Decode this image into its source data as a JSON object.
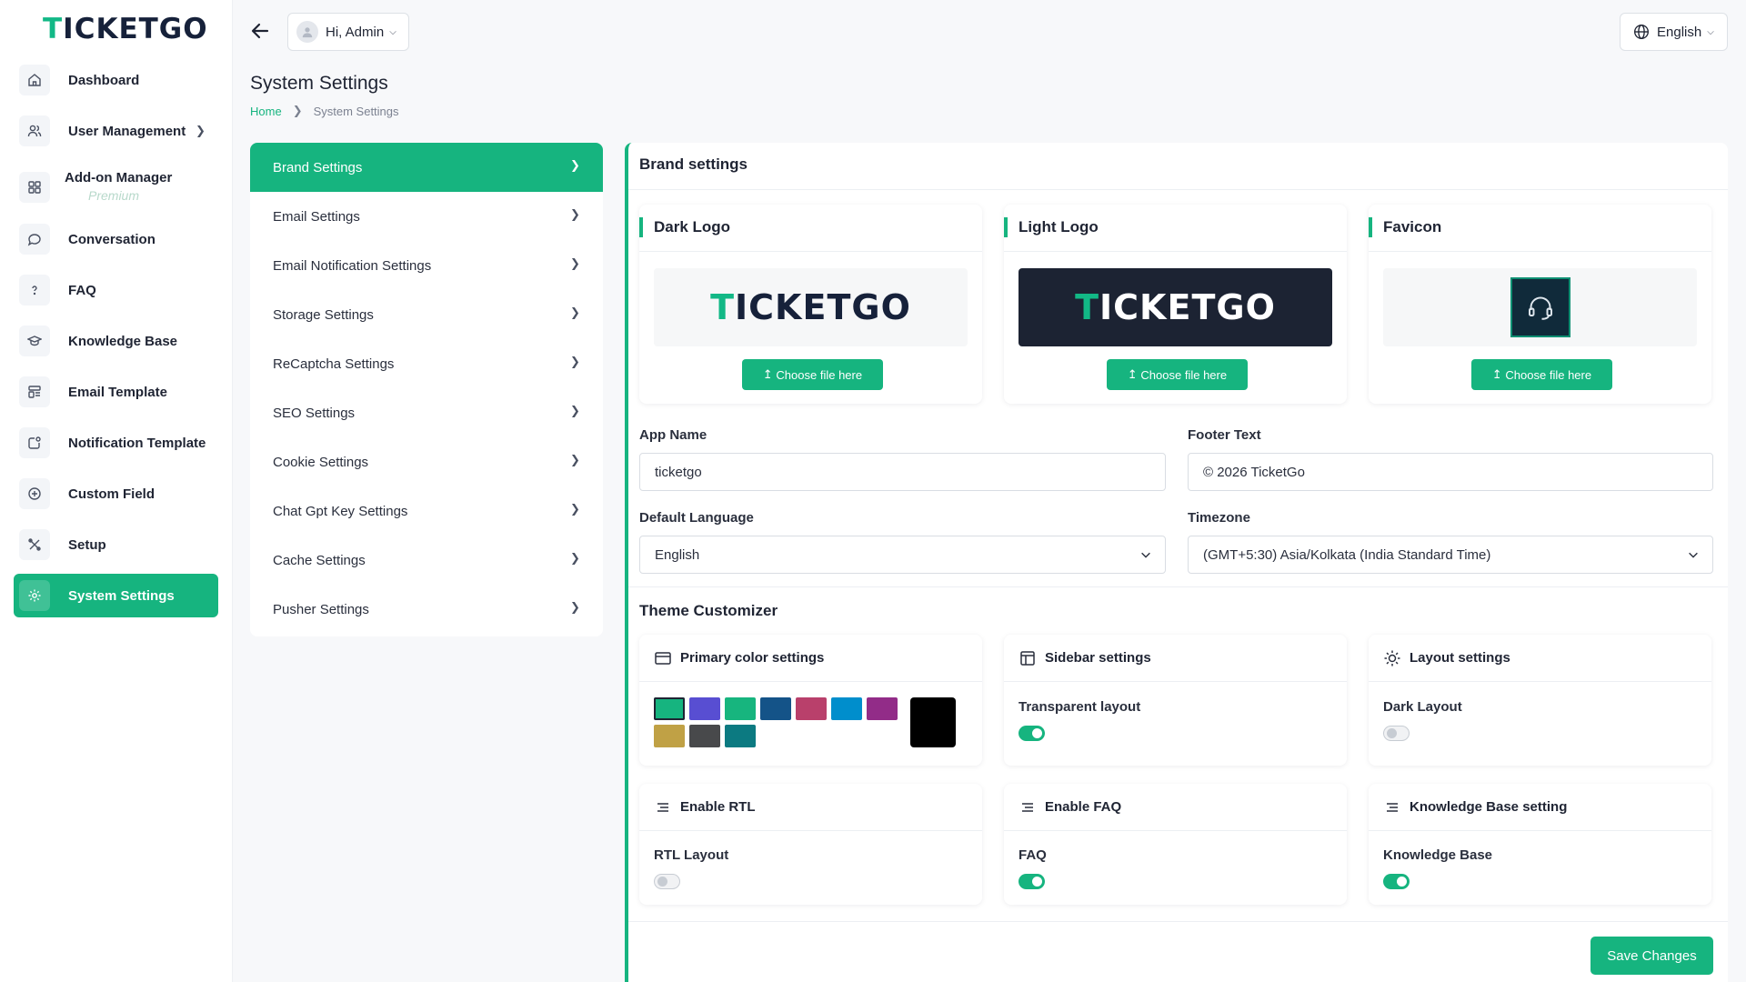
{
  "brand": {
    "logo_prefix": "T",
    "logo_rest": "ICKETGO"
  },
  "sidebar": {
    "items": [
      {
        "label": "Dashboard",
        "icon": "home-icon"
      },
      {
        "label": "User Management",
        "icon": "users-icon",
        "has_submenu": true
      },
      {
        "label": "Add-on Manager",
        "icon": "grid-icon",
        "badge": "Premium"
      },
      {
        "label": "Conversation",
        "icon": "chat-icon"
      },
      {
        "label": "FAQ",
        "icon": "question-icon"
      },
      {
        "label": "Knowledge Base",
        "icon": "graduation-cap-icon"
      },
      {
        "label": "Email Template",
        "icon": "template-icon"
      },
      {
        "label": "Notification Template",
        "icon": "notification-icon"
      },
      {
        "label": "Custom Field",
        "icon": "plus-circle-icon"
      },
      {
        "label": "Setup",
        "icon": "tools-icon"
      },
      {
        "label": "System Settings",
        "icon": "gear-icon",
        "active": true
      }
    ]
  },
  "topbar": {
    "user_label": "Hi, Admin",
    "language": "English"
  },
  "page": {
    "title": "System Settings",
    "breadcrumb_home": "Home",
    "breadcrumb_current": "System Settings"
  },
  "settings_menu": {
    "items": [
      {
        "label": "Brand Settings",
        "active": true
      },
      {
        "label": "Email Settings"
      },
      {
        "label": "Email Notification Settings"
      },
      {
        "label": "Storage Settings"
      },
      {
        "label": "ReCaptcha Settings"
      },
      {
        "label": "SEO Settings"
      },
      {
        "label": "Cookie Settings"
      },
      {
        "label": "Chat Gpt Key Settings"
      },
      {
        "label": "Cache Settings"
      },
      {
        "label": "Pusher Settings"
      }
    ]
  },
  "brand_settings": {
    "title": "Brand settings",
    "dark_logo": {
      "title": "Dark Logo",
      "button": "Choose file here"
    },
    "light_logo": {
      "title": "Light Logo",
      "button": "Choose file here"
    },
    "favicon": {
      "title": "Favicon",
      "button": "Choose file here"
    },
    "app_name": {
      "label": "App Name",
      "value": "ticketgo"
    },
    "footer_text": {
      "label": "Footer Text",
      "value": "© 2026 TicketGo"
    },
    "default_language": {
      "label": "Default Language",
      "value": "English"
    },
    "timezone": {
      "label": "Timezone",
      "value": "(GMT+5:30) Asia/Kolkata (India Standard Time)"
    }
  },
  "theme": {
    "title": "Theme Customizer",
    "primary_color": {
      "title": "Primary color settings",
      "swatches": [
        "#16b47f",
        "#584ed2",
        "#17b57e",
        "#145388",
        "#b9406b",
        "#008ecc",
        "#922c88",
        "#c0a145",
        "#48494b",
        "#0c7a81"
      ],
      "selected": "#16b47f",
      "custom_color": "#000000"
    },
    "sidebar": {
      "title": "Sidebar settings",
      "option_label": "Transparent layout",
      "enabled": true
    },
    "layout": {
      "title": "Layout settings",
      "option_label": "Dark Layout",
      "enabled": false
    },
    "rtl": {
      "title": "Enable RTL",
      "option_label": "RTL Layout",
      "enabled": false
    },
    "faq": {
      "title": "Enable FAQ",
      "option_label": "FAQ",
      "enabled": true
    },
    "knowledge_base": {
      "title": "Knowledge Base setting",
      "option_label": "Knowledge Base",
      "enabled": true
    }
  },
  "actions": {
    "save_label": "Save Changes"
  },
  "colors": {
    "accent": "#16b47f",
    "text": "#1f2433"
  }
}
